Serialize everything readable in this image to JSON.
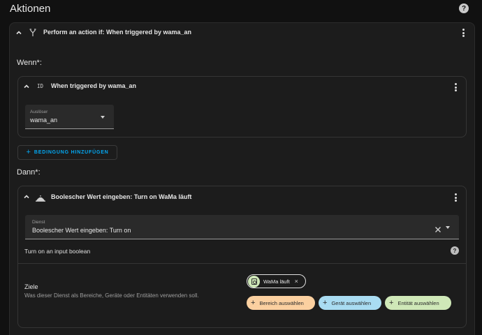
{
  "page": {
    "title": "Aktionen",
    "help_icon": "help-circle-icon"
  },
  "outer_action": {
    "title": "Perform an action if: When triggered by wama_an",
    "icon": "branch-icon"
  },
  "if_section": {
    "label": "Wenn*:",
    "condition": {
      "type_label": "ID",
      "title": "When triggered by wama_an",
      "select_label": "Auslöser",
      "select_value": "wama_an"
    },
    "add_condition_label": "BEDINGUNG HINZUFÜGEN"
  },
  "then_section": {
    "label": "Dann*:",
    "action": {
      "title": "Boolescher Wert eingeben: Turn on WaMa läuft",
      "service_label": "Dienst",
      "service_value": "Boolescher Wert eingeben: Turn on",
      "description": "Turn on an input boolean",
      "targets_label": "Ziele",
      "targets_description": "Was dieser Dienst als Bereiche, Geräte oder Entitäten verwenden soll.",
      "entity_chip": "WaMa läuft",
      "area_button": "Bereich auswählen",
      "device_button": "Gerät auswählen",
      "entity_button": "Entität auswählen"
    }
  },
  "colors": {
    "accent": "#03a9f4",
    "area_chip": "#fbd0a0",
    "device_chip": "#a9dcf2",
    "entity_chip": "#cfe8b8"
  }
}
